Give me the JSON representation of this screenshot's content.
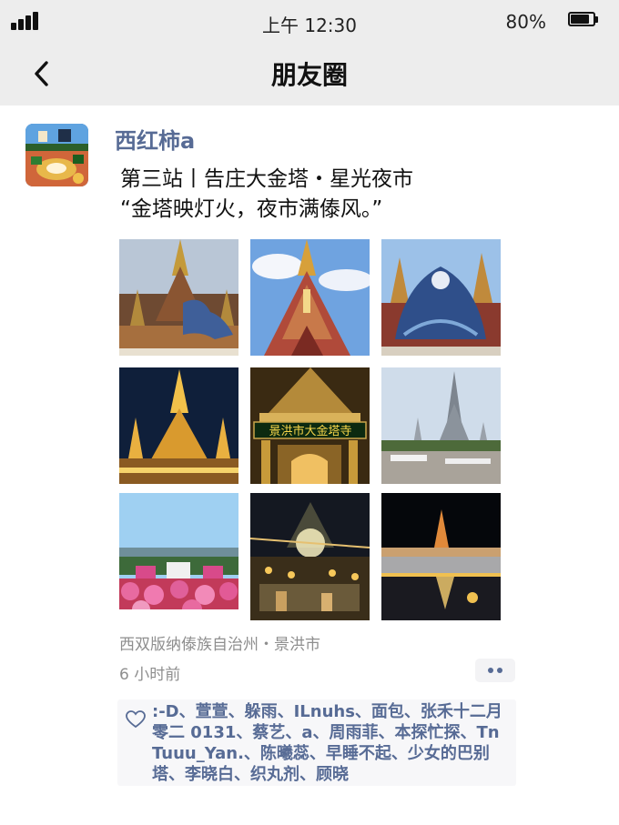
{
  "status_bar": {
    "time": "上午 12:30",
    "battery_percent": "80%",
    "signal_icon": "signal-icon",
    "battery_icon": "battery-icon",
    "battery_level": 0.8
  },
  "nav": {
    "title": "朋友圈",
    "back_icon": "chevron-left-icon"
  },
  "post": {
    "username": "西红柿a",
    "text_line1": "第三站丨告庄大金塔・星光夜市",
    "text_line2": "“金塔映灯火，夜市满傣风。”",
    "photos": [
      "golden-pagoda-blue-dragon-photo",
      "red-golden-stupa-photo",
      "blue-dragon-statue-photo",
      "illuminated-golden-temple-night-photo",
      "temple-gate-sign-photo",
      "riverside-temple-photo",
      "night-market-umbrellas-photo",
      "night-market-lights-photo",
      "temple-at-night-bridge-photo"
    ],
    "photo_sign_text": "景洪市大金塔寺",
    "location": "西双版纳傣族自治州・景洪市",
    "time_ago": "6 小时前",
    "more_icon": "more-dots-icon",
    "like_icon": "heart-icon",
    "likes": ":-D、萱萱、躲雨、ILnuhs、面包、张禾十二月零二 0131、蔡艺、a、周雨菲、本探忙探、TnTuuu_Yan.、陈曦蕊、早睡不起、少女的巴别塔、李晓白、织丸剂、顾晓"
  },
  "colors": {
    "name_blue": "#576b95",
    "header_bg": "#ededed",
    "likes_bg": "#f7f7f9"
  }
}
